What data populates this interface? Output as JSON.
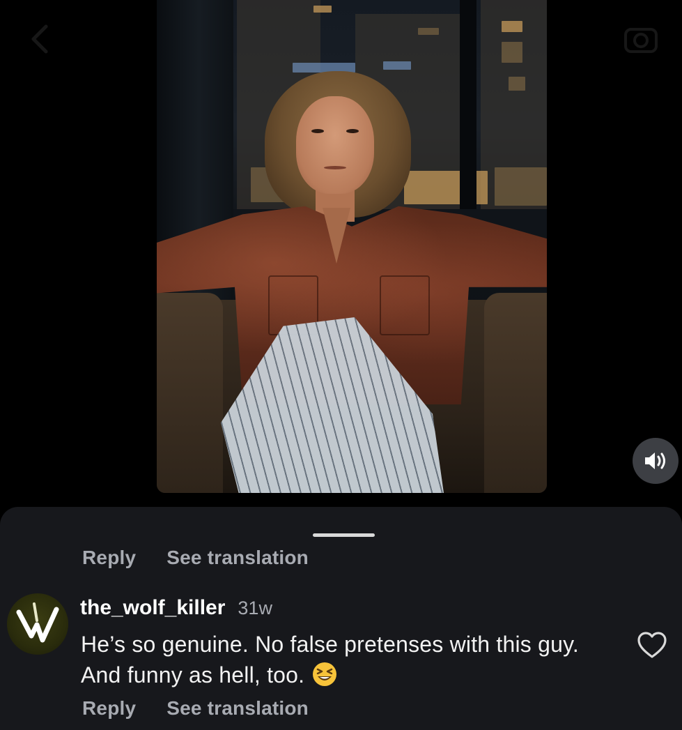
{
  "video": {
    "sound_icon": "speaker-volume-icon"
  },
  "sheet": {
    "previous_comment_actions": {
      "reply_label": "Reply",
      "translate_label": "See translation"
    },
    "comment": {
      "username": "the_wolf_killer",
      "timestamp": "31w",
      "text": "He’s so genuine. No false pretenses with this guy. And funny as hell, too.",
      "emoji": "grinning-squinting-face",
      "like_icon": "heart-outline-icon",
      "reply_label": "Reply",
      "translate_label": "See translation"
    }
  },
  "colors": {
    "background": "#000000",
    "sheet": "#17181c",
    "muted_text": "#a8abb2",
    "primary_text": "#ffffff",
    "sound_button": "#3d3f44"
  }
}
